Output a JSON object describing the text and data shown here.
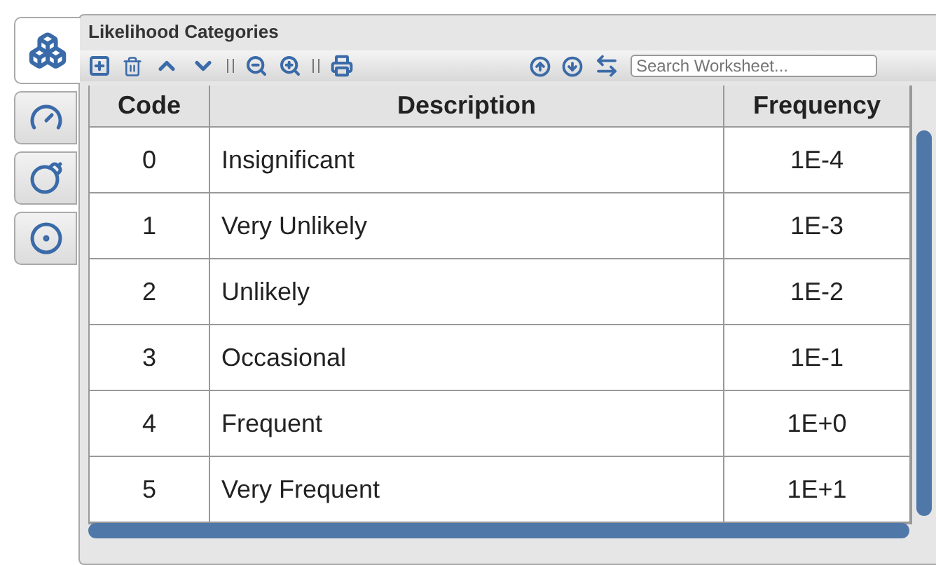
{
  "side_tabs": [
    {
      "selected": true
    },
    {
      "selected": false
    },
    {
      "selected": false
    },
    {
      "selected": false
    }
  ],
  "panel": {
    "title": "Likelihood Categories"
  },
  "search": {
    "placeholder": "Search Worksheet..."
  },
  "table": {
    "columns": [
      "Code",
      "Description",
      "Frequency"
    ],
    "rows": [
      [
        "0",
        "Insignificant",
        "1E-4"
      ],
      [
        "1",
        "Very Unlikely",
        "1E-3"
      ],
      [
        "2",
        "Unlikely",
        "1E-2"
      ],
      [
        "3",
        "Occasional",
        "1E-1"
      ],
      [
        "4",
        "Frequent",
        "1E+0"
      ],
      [
        "5",
        "Very Frequent",
        "1E+1"
      ]
    ]
  }
}
